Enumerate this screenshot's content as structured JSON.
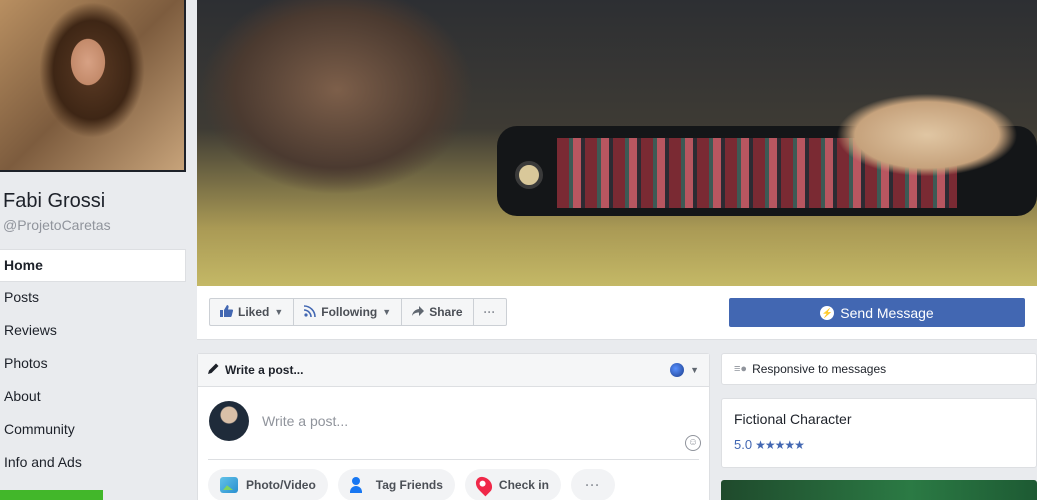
{
  "profile": {
    "name": "Fabi Grossi",
    "handle": "@ProjetoCaretas"
  },
  "left_nav": {
    "items": [
      {
        "label": "Home",
        "active": true
      },
      {
        "label": "Posts"
      },
      {
        "label": "Reviews"
      },
      {
        "label": "Photos"
      },
      {
        "label": "About"
      },
      {
        "label": "Community"
      },
      {
        "label": "Info and Ads"
      }
    ]
  },
  "action_bar": {
    "liked_label": "Liked",
    "following_label": "Following",
    "share_label": "Share",
    "more_label": "···",
    "send_message_label": "Send Message"
  },
  "composer": {
    "header_label": "Write a post...",
    "placeholder": "Write a post...",
    "actions": {
      "photo_video": "Photo/Video",
      "tag_friends": "Tag Friends",
      "check_in": "Check in",
      "more": "···"
    }
  },
  "sidebar": {
    "responsive_label": "Responsive to messages",
    "category": "Fictional Character",
    "rating_value": "5.0",
    "rating_stars": 5
  },
  "colors": {
    "brand_blue": "#4267b2",
    "green": "#42b72a",
    "background": "#e9ebee"
  },
  "icons": [
    "pencil-icon",
    "globe-icon",
    "thumbs-up-icon",
    "rss-icon",
    "share-arrow-icon",
    "messenger-icon",
    "photo-icon",
    "tag-friends-icon",
    "location-pin-icon",
    "emoji-icon",
    "star-icon"
  ]
}
